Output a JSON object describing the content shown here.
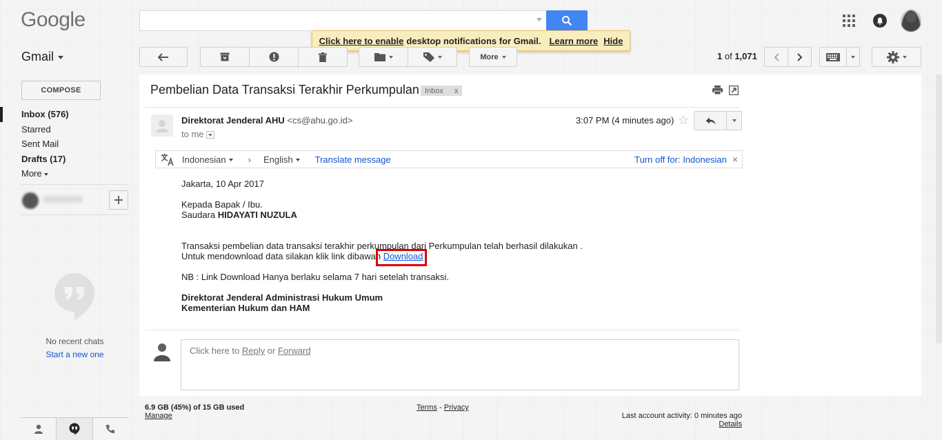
{
  "header": {
    "logo": "Google",
    "search_value": "",
    "notification": {
      "enable_link": "Click here to enable",
      "text": "desktop notifications for Gmail.",
      "learn_more": "Learn more",
      "hide": "Hide"
    }
  },
  "toolbar": {
    "app_label": "Gmail",
    "more_label": "More",
    "pager": {
      "range": "1",
      "of": "of",
      "total": "1,071"
    }
  },
  "sidebar": {
    "compose_label": "COMPOSE",
    "items": [
      {
        "label": "Inbox (576)",
        "bold": true,
        "active": true
      },
      {
        "label": "Starred",
        "bold": false
      },
      {
        "label": "Sent Mail",
        "bold": false
      },
      {
        "label": "Drafts (17)",
        "bold": true
      },
      {
        "label": "More",
        "bold": false
      }
    ],
    "no_chats": "No recent chats",
    "start_new": "Start a new one"
  },
  "email": {
    "subject": "Pembelian Data Transaksi Terakhir Perkumpulan",
    "label": "Inbox",
    "label_close": "x",
    "sender_name": "Direktorat Jenderal AHU",
    "sender_email": "<cs@ahu.go.id>",
    "to": "to me",
    "time": "3:07 PM (4 minutes ago)",
    "translate": {
      "from_lang": "Indonesian",
      "to_lang": "English",
      "translate_link": "Translate message",
      "turn_off": "Turn off for: Indonesian"
    },
    "body": {
      "date_line": "Jakarta, 10 Apr 2017",
      "greeting1": "Kepada Bapak / Ibu.",
      "greeting2_prefix": "Saudara",
      "greeting2_name": "HIDAYATI NUZULA",
      "para1": "Transaksi pembelian data transaksi terakhir perkumpulan dari Perkumpulan telah berhasil dilakukan .",
      "para2_prefix": "Untuk mendownload data silakan klik link dibawah",
      "download_link": "Download",
      "nb": "NB : Link Download Hanya berlaku selama 7 hari setelah transaksi.",
      "sign1": "Direktorat Jenderal Administrasi Hukum Umum",
      "sign2": "Kementerian Hukum dan HAM"
    },
    "reply_prompt": {
      "prefix": "Click here to",
      "reply": "Reply",
      "or": "or",
      "forward": "Forward"
    }
  },
  "footer": {
    "storage": "6.9 GB (45%) of 15 GB used",
    "manage": "Manage",
    "terms": "Terms",
    "dash": "-",
    "privacy": "Privacy",
    "last_activity": "Last account activity: 0 minutes ago",
    "details": "Details"
  },
  "colors": {
    "search_blue": "#4285f4",
    "link_blue": "#1155cc",
    "highlight_red": "#dd0000",
    "notif_yellow": "#f9edbe"
  }
}
